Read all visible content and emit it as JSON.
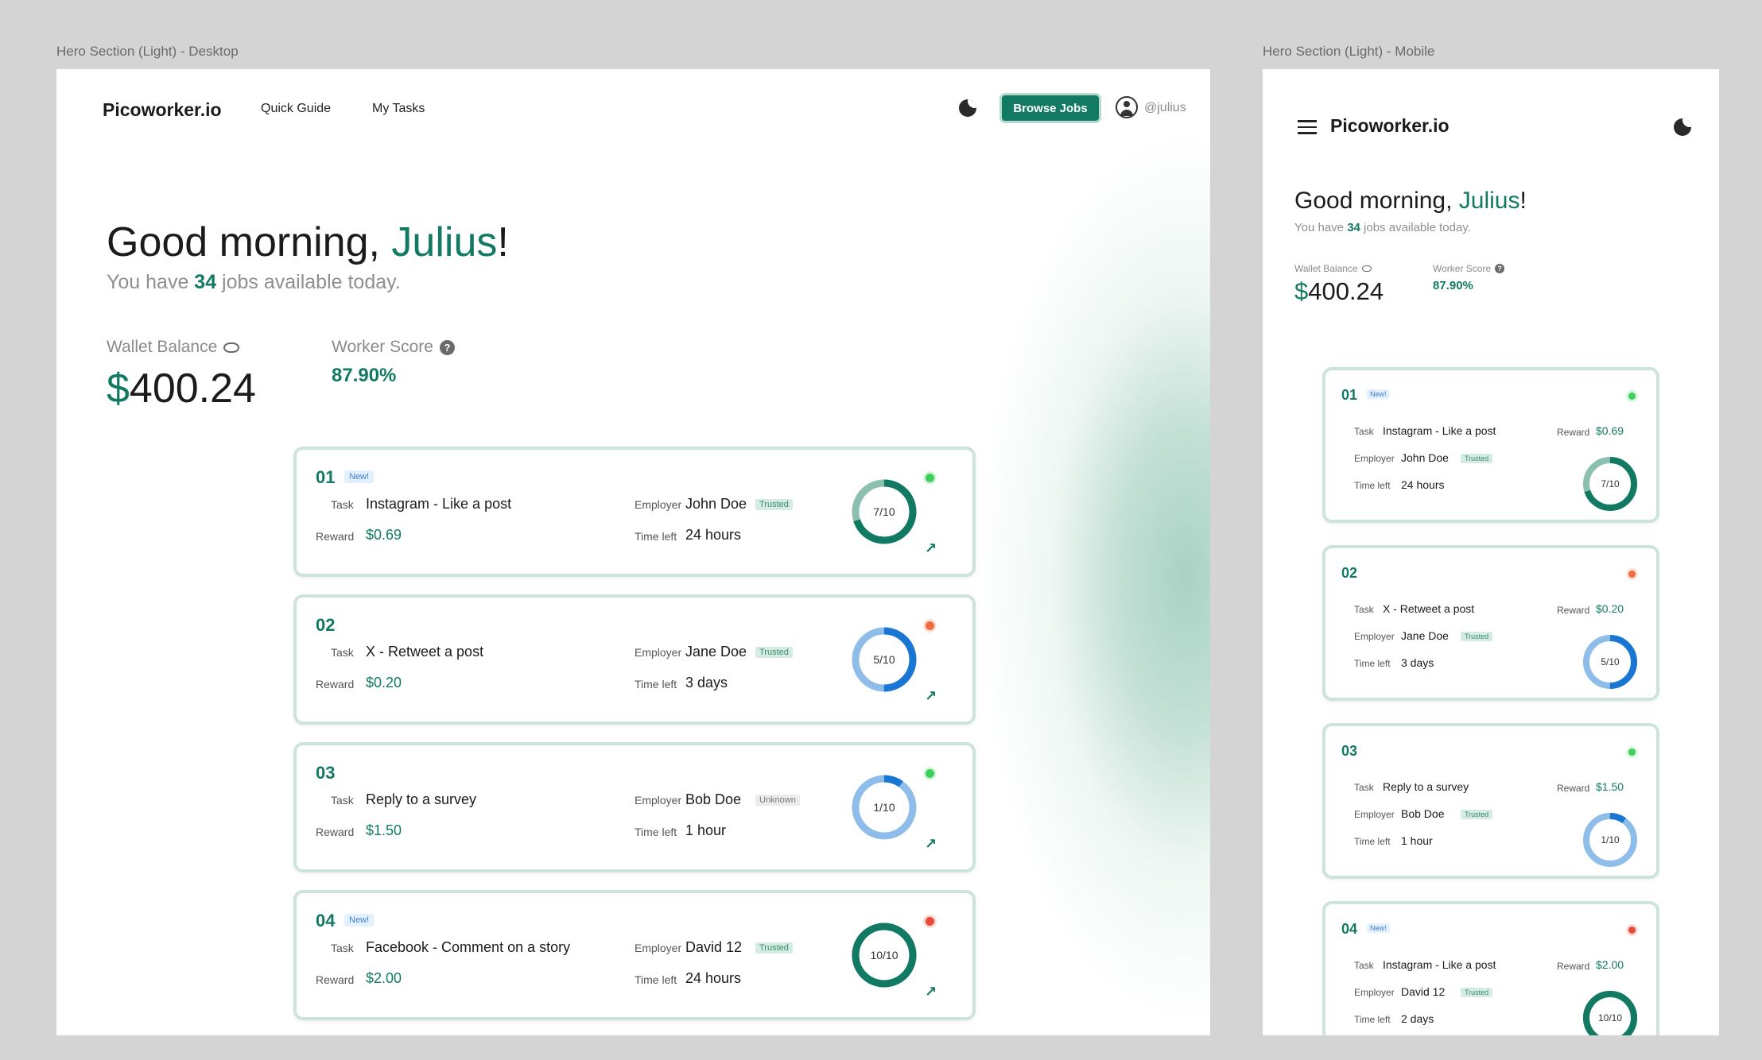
{
  "frames": {
    "desktop_label": "Hero Section (Light) - Desktop",
    "mobile_label": "Hero Section (Light) - Mobile"
  },
  "brand": "Picoworker.io",
  "nav": {
    "quick_guide": "Quick Guide",
    "my_tasks": "My Tasks",
    "browse_jobs": "Browse Jobs",
    "username": "@julius"
  },
  "greeting": {
    "prefix": "Good morning, ",
    "name": "Julius",
    "suffix": "!",
    "sub_prefix": "You have ",
    "job_count": "34",
    "sub_suffix": " jobs available today."
  },
  "stats": {
    "wallet_label": "Wallet Balance",
    "wallet_currency": "$",
    "wallet_amount": "400.24",
    "score_label": "Worker Score",
    "score_value": "87.90%"
  },
  "labels": {
    "task": "Task",
    "reward": "Reward",
    "employer": "Employer",
    "time_left": "Time left",
    "new": "New!"
  },
  "colors": {
    "accent": "#127a62",
    "status_green": "#3ecf5b",
    "status_orange": "#f06b3f",
    "status_red": "#e84a3a",
    "ring_blue": "#1976d2"
  },
  "jobs": [
    {
      "num": "01",
      "is_new": true,
      "task": "Instagram - Like a post",
      "reward": "$0.69",
      "employer": "John Doe",
      "trust": "Trusted",
      "time_left": "24 hours",
      "progress": "7/10",
      "status": "green"
    },
    {
      "num": "02",
      "is_new": false,
      "task": "X - Retweet a post",
      "reward": "$0.20",
      "employer": "Jane Doe",
      "trust": "Trusted",
      "time_left": "3 days",
      "progress": "5/10",
      "status": "orange"
    },
    {
      "num": "03",
      "is_new": false,
      "task": "Reply to a survey",
      "reward": "$1.50",
      "employer": "Bob Doe",
      "trust": "Unknown",
      "time_left": "1 hour",
      "progress": "1/10",
      "status": "green"
    },
    {
      "num": "04",
      "is_new": true,
      "task": "Facebook - Comment on a story",
      "reward": "$2.00",
      "employer": "David 12",
      "trust": "Trusted",
      "time_left": "24 hours",
      "progress": "10/10",
      "status": "red"
    }
  ],
  "mobile_jobs": [
    {
      "num": "01",
      "is_new": true,
      "task": "Instagram - Like a post",
      "reward": "$0.69",
      "employer": "John Doe",
      "trust": "Trusted",
      "time_left": "24 hours",
      "progress": "7/10",
      "status": "green"
    },
    {
      "num": "02",
      "is_new": false,
      "task": "X - Retweet a post",
      "reward": "$0.20",
      "employer": "Jane Doe",
      "trust": "Trusted",
      "time_left": "3 days",
      "progress": "5/10",
      "status": "orange"
    },
    {
      "num": "03",
      "is_new": false,
      "task": "Reply to a survey",
      "reward": "$1.50",
      "employer": "Bob Doe",
      "trust": "Trusted",
      "time_left": "1 hour",
      "progress": "1/10",
      "status": "green"
    },
    {
      "num": "04",
      "is_new": true,
      "task": "Instagram - Like a post",
      "reward": "$2.00",
      "employer": "David 12",
      "trust": "Trusted",
      "time_left": "2 days",
      "progress": "10/10",
      "status": "red"
    }
  ]
}
